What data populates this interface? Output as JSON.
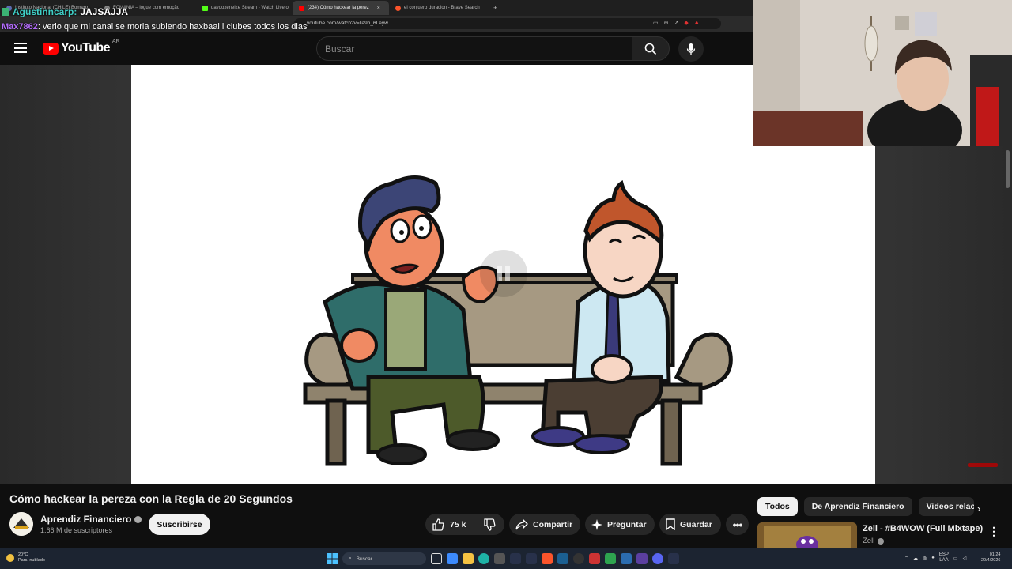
{
  "browser": {
    "tabs": [
      {
        "label": "Instituto Nacional (CHILE) Bomero",
        "active": false
      },
      {
        "label": "FCMANIA – logue com emoção",
        "active": false
      },
      {
        "label": "davooxeneize Stream - Watch Live o",
        "active": false
      },
      {
        "label": "(234) Cómo hackear la perez",
        "active": true
      },
      {
        "label": "el conjuero duracion - Brave Search",
        "active": false
      }
    ],
    "new_tab": "+",
    "close_tab": "×",
    "url": "youtube.com/watch?v=lia9h_6Leyw"
  },
  "chat": {
    "line1_user": "Agustinncarp:",
    "line1_text": "JAJSAJJA",
    "line2_user": "Max7862",
    "line2_text": ": verlo que mi canal se moria subiendo haxbaal i clubes todos los dias"
  },
  "youtube": {
    "logo": "YouTube",
    "region": "AR",
    "search_placeholder": "Buscar"
  },
  "video": {
    "title": "Cómo hackear la pereza con la Regla de 20 Segundos",
    "channel": "Aprendiz Financiero",
    "subscribers": "1.66 M de suscriptores",
    "subscribe_label": "Suscribirse",
    "likes": "75 k",
    "share_label": "Compartir",
    "ask_label": "Preguntar",
    "save_label": "Guardar",
    "more_label": "•••"
  },
  "sidebar": {
    "chips": [
      "Todos",
      "De Aprendiz Financiero",
      "Videos relacio"
    ],
    "next": "›",
    "recommended": {
      "title": "Zell - #B4WOW (Full Mixtape)",
      "channel": "Zell"
    },
    "more": "⋮"
  },
  "taskbar": {
    "temperature": "20°C",
    "weather": "Parc. nublado",
    "search": "Buscar",
    "lang1": "ESP",
    "lang2": "LAA",
    "time": "01:24",
    "date": "20/4/2026"
  },
  "colors": {
    "yt_red": "#ff0000",
    "background": "#0f0f0f",
    "chip_bg": "#272727",
    "taskbar": "#1c2431"
  }
}
